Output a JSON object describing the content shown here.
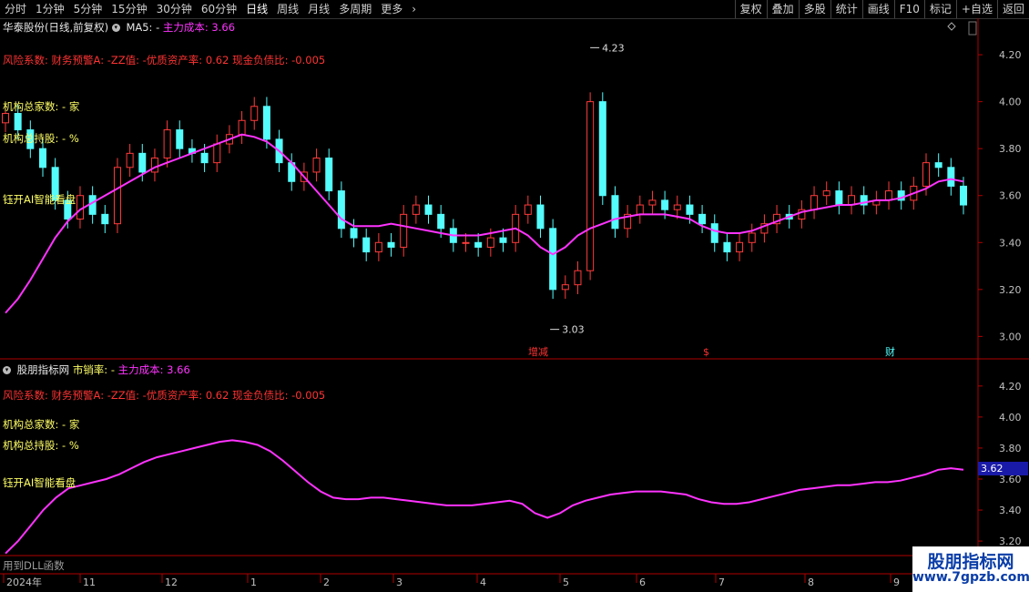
{
  "toolbar": {
    "periods": [
      "分时",
      "1分钟",
      "5分钟",
      "15分钟",
      "30分钟",
      "60分钟",
      "日线",
      "周线",
      "月线",
      "多周期",
      "更多"
    ],
    "active_period": "日线",
    "right_buttons": [
      "复权",
      "叠加",
      "多股",
      "统计",
      "画线",
      "F10",
      "标记",
      "+自选",
      "返回"
    ]
  },
  "main_panel": {
    "title": "华泰股份(日线,前复权)",
    "ma_label": "MA5: -",
    "cost_label": "主力成本: 3.66",
    "risk_text": "风险系数: 财务预警A: -ZZ值: -优质资产率: 0.62 现金负债比: -0.005",
    "inst_count": "机构总家数:  -  家",
    "inst_hold": "机构总持股:  -  %",
    "ai_text": "钰开AI智能看盘",
    "markers": [
      "增减",
      "$",
      "财"
    ],
    "diamond_icon": "diamond-icon",
    "scroll_icon": "scrollbar-icon"
  },
  "sub_panel": {
    "title": "股朋指标网",
    "pe_label": "市销率: -",
    "cost_label": "主力成本: 3.66",
    "risk_text": "风险系数: 财务预警A: -ZZ值: -优质资产率: 0.62 现金负债比: -0.005",
    "inst_count": "机构总家数:  -  家",
    "inst_hold": "机构总持股:  -  %",
    "ai_text": "钰开AI智能看盘",
    "price_tag": "3.62",
    "footer_text": "用到DLL函数"
  },
  "watermark": {
    "title": "股朋指标网",
    "url": "www.7gpzb.com"
  },
  "colors": {
    "up": "#ff3b3b",
    "down": "#54fcfc",
    "ma": "#ff33ff",
    "axis": "#b00000",
    "bg": "#000000"
  },
  "chart_data": [
    {
      "type": "candlestick",
      "name": "main",
      "y_ticks": [
        "4.20",
        "4.00",
        "3.80",
        "3.60",
        "3.40",
        "3.20",
        "3.00"
      ],
      "ylim": [
        2.92,
        4.34
      ],
      "annotations": [
        {
          "label": "4.23",
          "value": 4.23
        },
        {
          "label": "3.03",
          "value": 3.03
        }
      ],
      "ma_line": [
        3.1,
        3.16,
        3.24,
        3.33,
        3.42,
        3.49,
        3.54,
        3.57,
        3.6,
        3.63,
        3.66,
        3.69,
        3.72,
        3.74,
        3.76,
        3.78,
        3.8,
        3.82,
        3.84,
        3.86,
        3.85,
        3.83,
        3.79,
        3.74,
        3.68,
        3.62,
        3.56,
        3.5,
        3.47,
        3.47,
        3.47,
        3.48,
        3.47,
        3.46,
        3.45,
        3.44,
        3.43,
        3.43,
        3.43,
        3.44,
        3.45,
        3.46,
        3.43,
        3.38,
        3.35,
        3.38,
        3.43,
        3.46,
        3.48,
        3.5,
        3.51,
        3.52,
        3.52,
        3.52,
        3.51,
        3.5,
        3.47,
        3.45,
        3.44,
        3.44,
        3.45,
        3.47,
        3.49,
        3.51,
        3.53,
        3.54,
        3.55,
        3.56,
        3.56,
        3.57,
        3.58,
        3.58,
        3.59,
        3.61,
        3.63,
        3.66,
        3.67,
        3.66
      ],
      "close": [
        3.95,
        3.88,
        3.8,
        3.72,
        3.58,
        3.5,
        3.6,
        3.52,
        3.48,
        3.72,
        3.78,
        3.7,
        3.76,
        3.88,
        3.8,
        3.78,
        3.74,
        3.82,
        3.86,
        3.92,
        3.98,
        3.84,
        3.74,
        3.66,
        3.7,
        3.76,
        3.62,
        3.46,
        3.42,
        3.36,
        3.4,
        3.38,
        3.52,
        3.56,
        3.52,
        3.46,
        3.4,
        3.4,
        3.38,
        3.42,
        3.4,
        3.52,
        3.56,
        3.46,
        3.2,
        3.22,
        3.28,
        4.0,
        3.6,
        3.46,
        3.52,
        3.56,
        3.58,
        3.54,
        3.56,
        3.52,
        3.48,
        3.4,
        3.36,
        3.4,
        3.44,
        3.48,
        3.52,
        3.5,
        3.54,
        3.6,
        3.62,
        3.56,
        3.6,
        3.56,
        3.58,
        3.62,
        3.58,
        3.64,
        3.74,
        3.72,
        3.64,
        3.56
      ],
      "x_labels": [
        "2024年",
        "11",
        "12",
        "1",
        "2",
        "3",
        "4",
        "5",
        "6",
        "7",
        "8",
        "9"
      ]
    },
    {
      "type": "line",
      "name": "sub",
      "y_ticks": [
        "4.20",
        "4.00",
        "3.80",
        "3.60",
        "3.40",
        "3.20"
      ],
      "ylim": [
        3.13,
        4.34
      ],
      "values": [
        3.12,
        3.2,
        3.3,
        3.4,
        3.48,
        3.54,
        3.56,
        3.58,
        3.6,
        3.63,
        3.67,
        3.71,
        3.74,
        3.76,
        3.78,
        3.8,
        3.82,
        3.84,
        3.85,
        3.84,
        3.82,
        3.78,
        3.72,
        3.65,
        3.58,
        3.52,
        3.48,
        3.47,
        3.47,
        3.48,
        3.48,
        3.47,
        3.46,
        3.45,
        3.44,
        3.43,
        3.43,
        3.43,
        3.44,
        3.45,
        3.46,
        3.44,
        3.38,
        3.35,
        3.38,
        3.43,
        3.46,
        3.48,
        3.5,
        3.51,
        3.52,
        3.52,
        3.52,
        3.51,
        3.5,
        3.47,
        3.45,
        3.44,
        3.44,
        3.45,
        3.47,
        3.49,
        3.51,
        3.53,
        3.54,
        3.55,
        3.56,
        3.56,
        3.57,
        3.58,
        3.58,
        3.59,
        3.61,
        3.63,
        3.66,
        3.67,
        3.66
      ]
    }
  ]
}
